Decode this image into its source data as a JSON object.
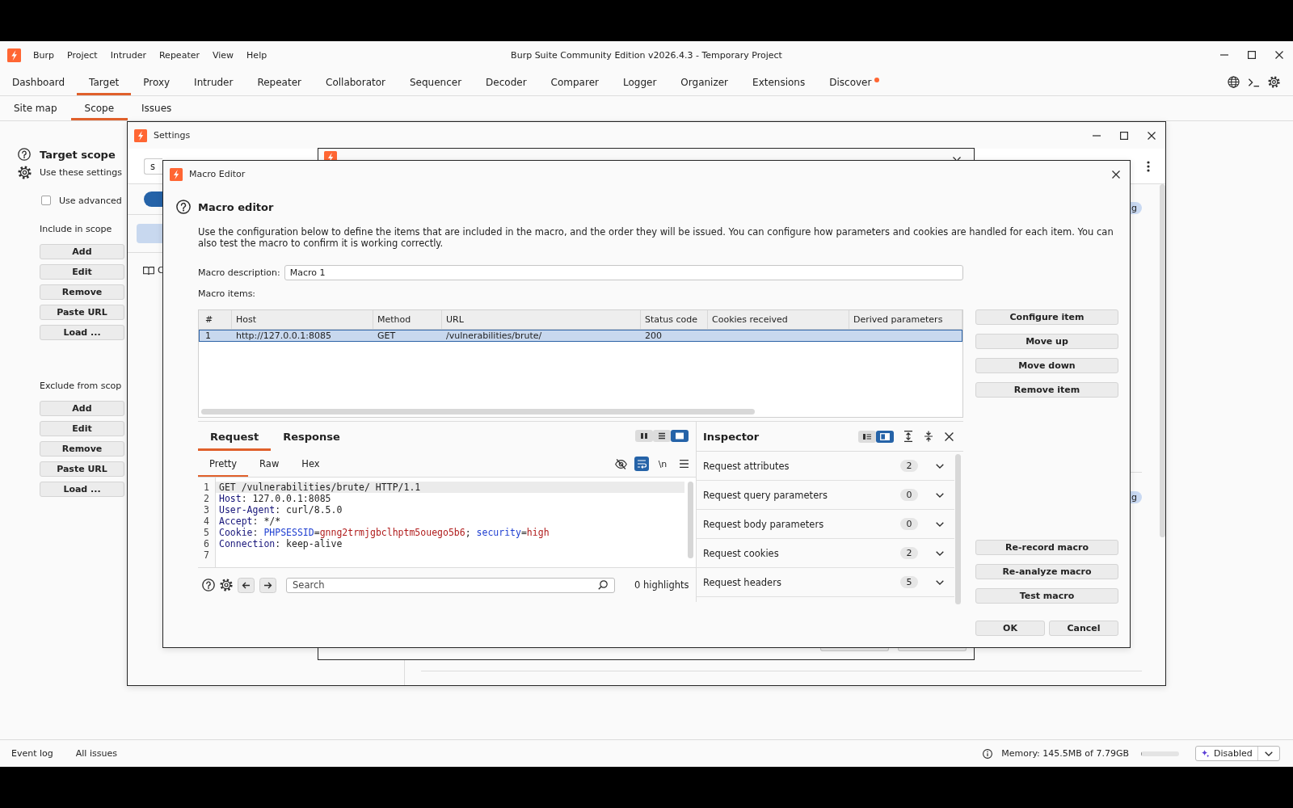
{
  "app": {
    "title": "Burp Suite Community Edition v2026.4.3 - Temporary Project",
    "menu": [
      "Burp",
      "Project",
      "Intruder",
      "Repeater",
      "View",
      "Help"
    ],
    "tabs": [
      {
        "label": "Dashboard",
        "selected": false,
        "notification": false
      },
      {
        "label": "Target",
        "selected": true,
        "notification": false
      },
      {
        "label": "Proxy",
        "selected": false,
        "notification": false
      },
      {
        "label": "Intruder",
        "selected": false,
        "notification": false
      },
      {
        "label": "Repeater",
        "selected": false,
        "notification": false
      },
      {
        "label": "Collaborator",
        "selected": false,
        "notification": false
      },
      {
        "label": "Sequencer",
        "selected": false,
        "notification": false
      },
      {
        "label": "Decoder",
        "selected": false,
        "notification": false
      },
      {
        "label": "Comparer",
        "selected": false,
        "notification": false
      },
      {
        "label": "Logger",
        "selected": false,
        "notification": false
      },
      {
        "label": "Organizer",
        "selected": false,
        "notification": false
      },
      {
        "label": "Extensions",
        "selected": false,
        "notification": false
      },
      {
        "label": "Discover",
        "selected": false,
        "notification": true
      }
    ],
    "subtabs": [
      {
        "label": "Site map",
        "selected": false
      },
      {
        "label": "Scope",
        "selected": true
      },
      {
        "label": "Issues",
        "selected": false
      }
    ]
  },
  "scope": {
    "title": "Target scope",
    "settings_text": "Use these settings",
    "advanced": {
      "label": "Use advanced",
      "checked": false
    },
    "include": {
      "label": "Include in scope",
      "buttons": [
        "Add",
        "Edit",
        "Remove",
        "Paste URL",
        "Load ..."
      ]
    },
    "exclude": {
      "label": "Exclude from scop",
      "buttons": [
        "Add",
        "Edit",
        "Remove",
        "Paste URL",
        "Load ..."
      ]
    }
  },
  "settings": {
    "title": "Settings",
    "search": {
      "value": "s"
    },
    "nav_item": {
      "selected": true
    },
    "doc_link": "C",
    "badges": [
      "g",
      "g"
    ]
  },
  "macro_editor": {
    "title": "Macro Editor",
    "heading": "Macro editor",
    "intro": "Use the configuration below to define the items that are included in the macro, and the order they will be issued. You can configure how parameters and cookies are handled for each item. You can also test the macro to confirm it is working correctly.",
    "description": {
      "label": "Macro description:",
      "value": "Macro 1"
    },
    "items_label": "Macro items:",
    "table": {
      "columns": [
        "#",
        "Host",
        "Method",
        "URL",
        "Status code",
        "Cookies received",
        "Derived parameters"
      ],
      "rows": [
        {
          "cells": [
            "1",
            "http://127.0.0.1:8085",
            "GET",
            "/vulnerabilities/brute/",
            "200"
          ],
          "selected": true
        }
      ]
    },
    "item_buttons": [
      "Configure item",
      "Move up",
      "Move down",
      "Remove item"
    ],
    "macro_buttons": [
      "Re-record macro",
      "Re-analyze macro",
      "Test macro"
    ],
    "dialog_buttons": [
      "OK",
      "Cancel"
    ],
    "request_editor": {
      "tabs": [
        {
          "label": "Request",
          "selected": true
        },
        {
          "label": "Response",
          "selected": false
        }
      ],
      "layout_toggles": [
        {
          "kind": "side_by_side",
          "selected": false
        },
        {
          "kind": "stacked",
          "selected": false
        },
        {
          "kind": "single",
          "selected": true
        }
      ],
      "view_tabs": [
        {
          "label": "Pretty",
          "selected": true
        },
        {
          "label": "Raw",
          "selected": false
        },
        {
          "label": "Hex",
          "selected": false
        }
      ],
      "tools": [
        {
          "kind": "hide",
          "selected": false
        },
        {
          "kind": "wrap",
          "selected": true
        },
        {
          "kind": "newline",
          "label": "\\n",
          "selected": false
        },
        {
          "kind": "menu",
          "selected": false
        }
      ],
      "lines": [
        {
          "number": "1",
          "current": true,
          "tokens": [
            {
              "kind": "plain",
              "text": "GET /vulnerabilities/brute/ HTTP/1.1"
            }
          ]
        },
        {
          "number": "2",
          "current": false,
          "tokens": [
            {
              "kind": "header",
              "text": "Host"
            },
            {
              "kind": "plain",
              "text": ": 127.0.0.1:8085"
            }
          ]
        },
        {
          "number": "3",
          "current": false,
          "tokens": [
            {
              "kind": "header",
              "text": "User-Agent"
            },
            {
              "kind": "plain",
              "text": ": curl/8.5.0"
            }
          ]
        },
        {
          "number": "4",
          "current": false,
          "tokens": [
            {
              "kind": "header",
              "text": "Accept"
            },
            {
              "kind": "plain",
              "text": ": */*"
            }
          ]
        },
        {
          "number": "5",
          "current": false,
          "tokens": [
            {
              "kind": "header",
              "text": "Cookie"
            },
            {
              "kind": "plain",
              "text": ": "
            },
            {
              "kind": "cookie_name",
              "text": "PHPSESSID"
            },
            {
              "kind": "plain",
              "text": "="
            },
            {
              "kind": "cookie_value",
              "text": "gnng2trmjgbclhptm5ouego5b6"
            },
            {
              "kind": "plain",
              "text": "; "
            },
            {
              "kind": "cookie_name",
              "text": "security"
            },
            {
              "kind": "plain",
              "text": "="
            },
            {
              "kind": "cookie_value",
              "text": "high"
            }
          ]
        },
        {
          "number": "6",
          "current": false,
          "tokens": [
            {
              "kind": "header",
              "text": "Connection"
            },
            {
              "kind": "plain",
              "text": ": keep-alive"
            }
          ]
        },
        {
          "number": "7",
          "current": false
        }
      ],
      "search": {
        "placeholder": "Search"
      },
      "highlights": "0 highlights"
    },
    "inspector": {
      "title": "Inspector",
      "layout_toggles": [
        {
          "kind": "list",
          "selected": false
        },
        {
          "kind": "panel",
          "selected": true
        }
      ],
      "sections": [
        {
          "label": "Request attributes",
          "count": "2",
          "expanded": false
        },
        {
          "label": "Request query parameters",
          "count": "0",
          "expanded": false
        },
        {
          "label": "Request body parameters",
          "count": "0",
          "expanded": false
        },
        {
          "label": "Request cookies",
          "count": "2",
          "expanded": false
        },
        {
          "label": "Request headers",
          "count": "5",
          "expanded": false
        }
      ]
    }
  },
  "status_bar": {
    "links": [
      "Event log",
      "All issues"
    ],
    "memory": "Memory: 145.5MB of 7.79GB",
    "memory_meter": {
      "level": 0.02
    },
    "assistant": {
      "label": "Disabled"
    }
  }
}
